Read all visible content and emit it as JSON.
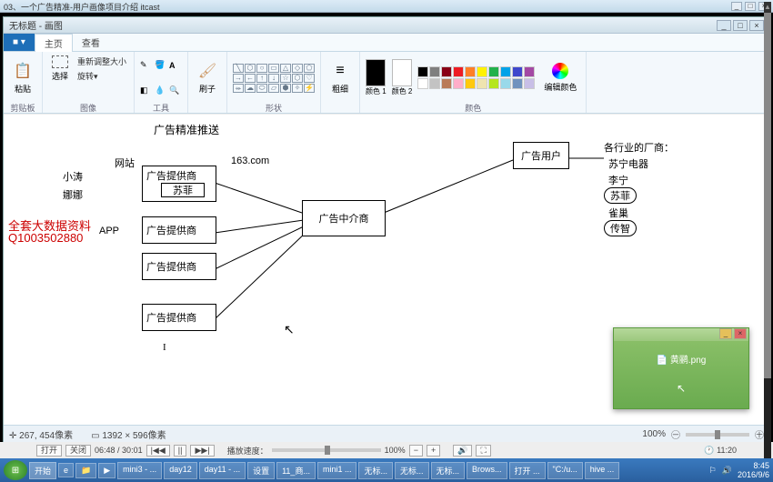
{
  "outerWindow": {
    "title": "03、一个广告精准-用户画像项目介绍 itcast"
  },
  "paintWindow": {
    "title": "无标题 - 画图"
  },
  "ribbon": {
    "fileTab": "■ ▾",
    "tabs": [
      "主页",
      "查看"
    ],
    "groups": {
      "clipboard": {
        "paste": "粘贴",
        "label": "剪贴板"
      },
      "image": {
        "select": "选择",
        "resize": "重新调整大小",
        "rotate": "旋转▾",
        "label": "图像"
      },
      "tools": {
        "label": "工具"
      },
      "brush": {
        "brush": "刷子",
        "label": ""
      },
      "shapes": {
        "label": "形状"
      },
      "size": {
        "size": "粗细",
        "label": ""
      },
      "colors": {
        "c1": "颜色 1",
        "c2": "颜色 2",
        "edit": "编辑颜色",
        "label": "颜色"
      }
    }
  },
  "canvas": {
    "title": "广告精准推送",
    "leftLabels": {
      "xiaotao": "小涛",
      "nana": "娜娜"
    },
    "website": "网站",
    "domain": "163.com",
    "app": "APP",
    "provider": "广告提供商",
    "sufei": "苏菲",
    "agency": "广告中介商",
    "aduser": "广告用户",
    "rightHeader": "各行业的厂商：",
    "brands": [
      "苏宁电器",
      "李宁",
      "苏菲",
      "雀巢",
      "传智"
    ],
    "watermark1": "全套大数据资料",
    "watermark2": "Q1003502880"
  },
  "status": {
    "coords": "267, 454像素",
    "size": "1392 × 596像素",
    "zoom": "100%",
    "plus": "㊉",
    "minus": "㊀"
  },
  "popup": {
    "file": "黄鹂.png"
  },
  "player": {
    "open": "打开",
    "close": "关闭",
    "time": "06:48 / 30:01",
    "speedLabel": "播放速度：",
    "speed": "100%",
    "clock": "11:20"
  },
  "taskbar": {
    "start": "开始",
    "items": [
      "mini3 - ...",
      "day12",
      "day11 - ...",
      "设置",
      "11_商...",
      "mini1 ...",
      "无标...",
      "无标...",
      "无标...",
      "Brows...",
      "打开 ...",
      "\"C:/u...",
      "hive ..."
    ],
    "time": "8:45",
    "date": "2016/9/6"
  },
  "palette": [
    "#000",
    "#7f7f7f",
    "#880015",
    "#ed1c24",
    "#ff7f27",
    "#fff200",
    "#22b14c",
    "#00a2e8",
    "#3f48cc",
    "#a349a4",
    "#fff",
    "#c3c3c3",
    "#b97a57",
    "#ffaec9",
    "#ffc90e",
    "#efe4b0",
    "#b5e61d",
    "#99d9ea",
    "#7092be",
    "#c8bfe7"
  ]
}
